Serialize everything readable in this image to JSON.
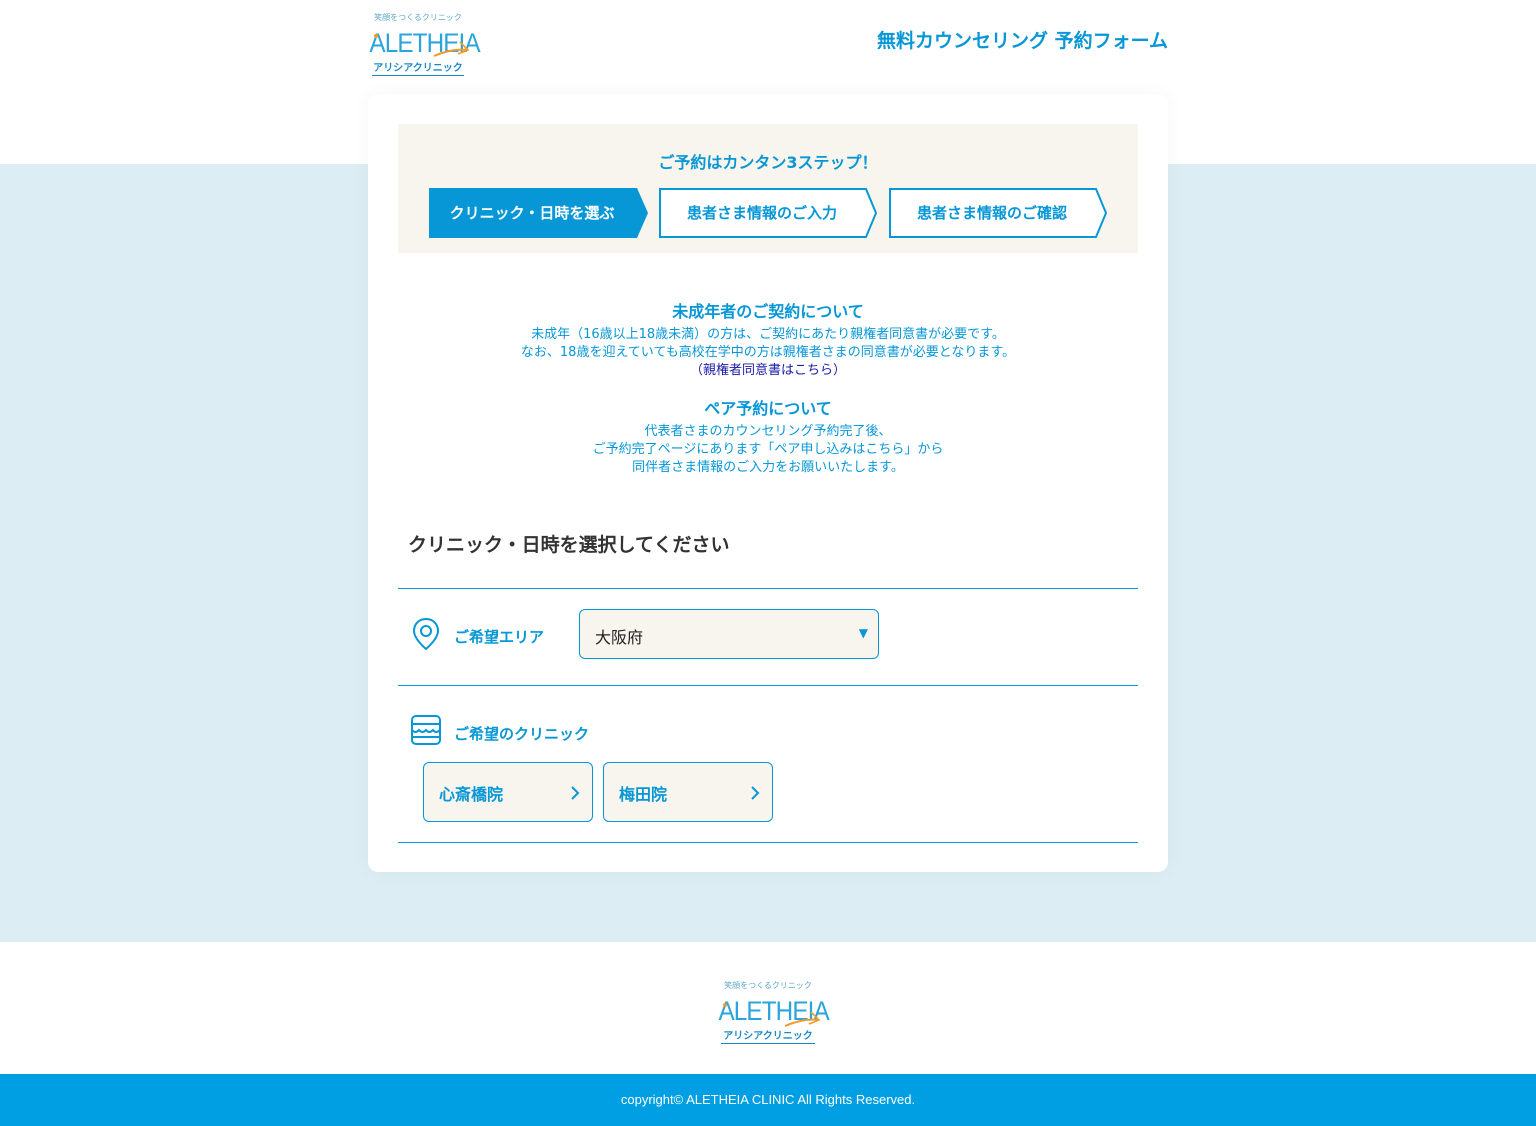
{
  "brand": {
    "tagline": "笑顔をつくるクリニック",
    "wordmark": "ALETHEIA",
    "subname": "アリシアクリニック"
  },
  "header": {
    "title": "無料カウンセリング 予約フォーム"
  },
  "steps": {
    "heading": "ご予約はカンタン3ステップ！",
    "items": [
      {
        "label": "クリニック・日時を選ぶ",
        "active": true
      },
      {
        "label": "患者さま情報のご入力",
        "active": false
      },
      {
        "label": "患者さま情報のご確認",
        "active": false
      }
    ]
  },
  "notices": {
    "minor": {
      "title": "未成年者のご契約について",
      "line1": "未成年（16歳以上18歳未満）の方は、ご契約にあたり親権者同意書が必要です。",
      "line2": "なお、18歳を迎えていても高校在学中の方は親権者さまの同意書が必要となります。",
      "link": "（親権者同意書はこちら）"
    },
    "pair": {
      "title": "ペア予約について",
      "line1": "代表者さまのカウンセリング予約完了後、",
      "line2": "ご予約完了ページにあります「ペア申し込みはこちら」から",
      "line3": "同伴者さま情報のご入力をお願いいたします。"
    }
  },
  "form": {
    "heading": "クリニック・日時を選択してください",
    "area": {
      "label": "ご希望エリア",
      "value": "大阪府",
      "caret": "▼"
    },
    "clinic": {
      "label": "ご希望のクリニック",
      "options": [
        "心斎橋院",
        "梅田院"
      ]
    }
  },
  "footer": {
    "copyright": "copyright© ALETHEIA CLINIC All Rights Reserved."
  },
  "colors": {
    "primary": "#0797d6",
    "band": "#dcedf3",
    "beige": "#f8f4ee",
    "footer": "#009fe3"
  }
}
